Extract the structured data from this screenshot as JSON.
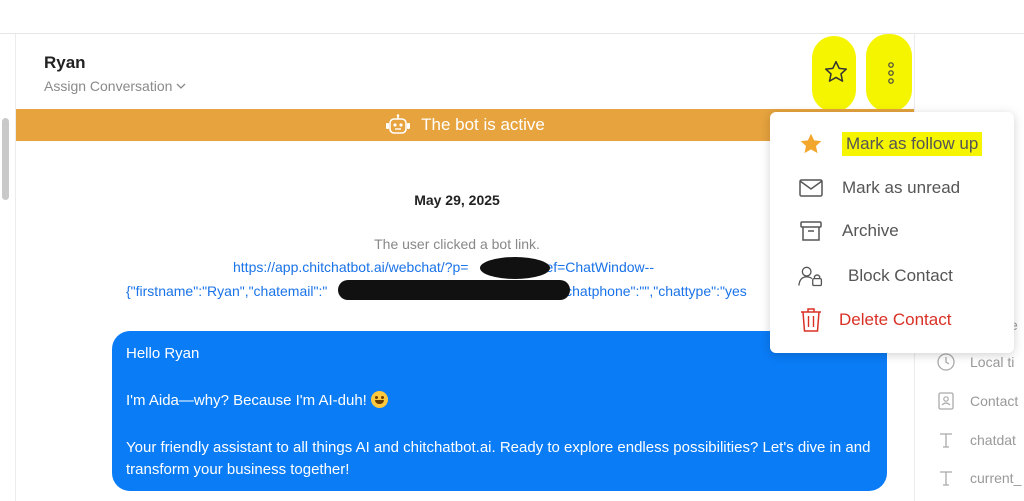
{
  "header": {
    "contact_name": "Ryan",
    "assign_label": "Assign Conversation"
  },
  "icons": {
    "favorite": "star-icon",
    "more": "more-vertical-icon",
    "bot": "robot-icon",
    "dropdown": "chevron-down-icon"
  },
  "bot_banner": {
    "text": "The bot is active",
    "color": "#E6A33E"
  },
  "conversation": {
    "date": "May 29, 2025",
    "notice": "The user clicked a bot link.",
    "link_line_1_start": "https://app.chitchatbot.ai/webchat/?p=",
    "link_line_1_end": "&ref=ChatWindow--",
    "link_line_2_start": "{\"firstname\":\"Ryan\",\"chatemail\":\"",
    "link_line_2_end": "\",\"chatphone\":\"\",\"chattype\":\"yes",
    "message": {
      "line1": "Hello Ryan",
      "line2": "I'm Aida—why? Because I'm AI-duh!",
      "line3": "Your friendly assistant to all things AI and chitchatbot.ai. Ready to explore endless possibilities? Let's dive in and transform your business together!",
      "bubble_color": "#0A7CF6"
    }
  },
  "context_menu": {
    "items": [
      {
        "label": "Mark as follow up",
        "icon": "star-filled-icon"
      },
      {
        "label": "Mark as unread",
        "icon": "envelope-icon"
      },
      {
        "label": "Archive",
        "icon": "archive-box-icon"
      },
      {
        "label": "Block Contact",
        "icon": "user-lock-icon"
      },
      {
        "label": "Delete Contact",
        "icon": "trash-icon"
      }
    ],
    "delete_color": "#D93025",
    "star_color": "#F2A72C"
  },
  "sidebar": {
    "e_text": "e",
    "rows": [
      {
        "label": "Local ti",
        "icon": "clock-icon"
      },
      {
        "label": "Contact",
        "icon": "contact-card-icon"
      },
      {
        "label": "chatdat",
        "icon": "text-t-icon"
      },
      {
        "label": "current_",
        "icon": "text-t-icon"
      }
    ]
  },
  "highlight_color": "#F5F500"
}
